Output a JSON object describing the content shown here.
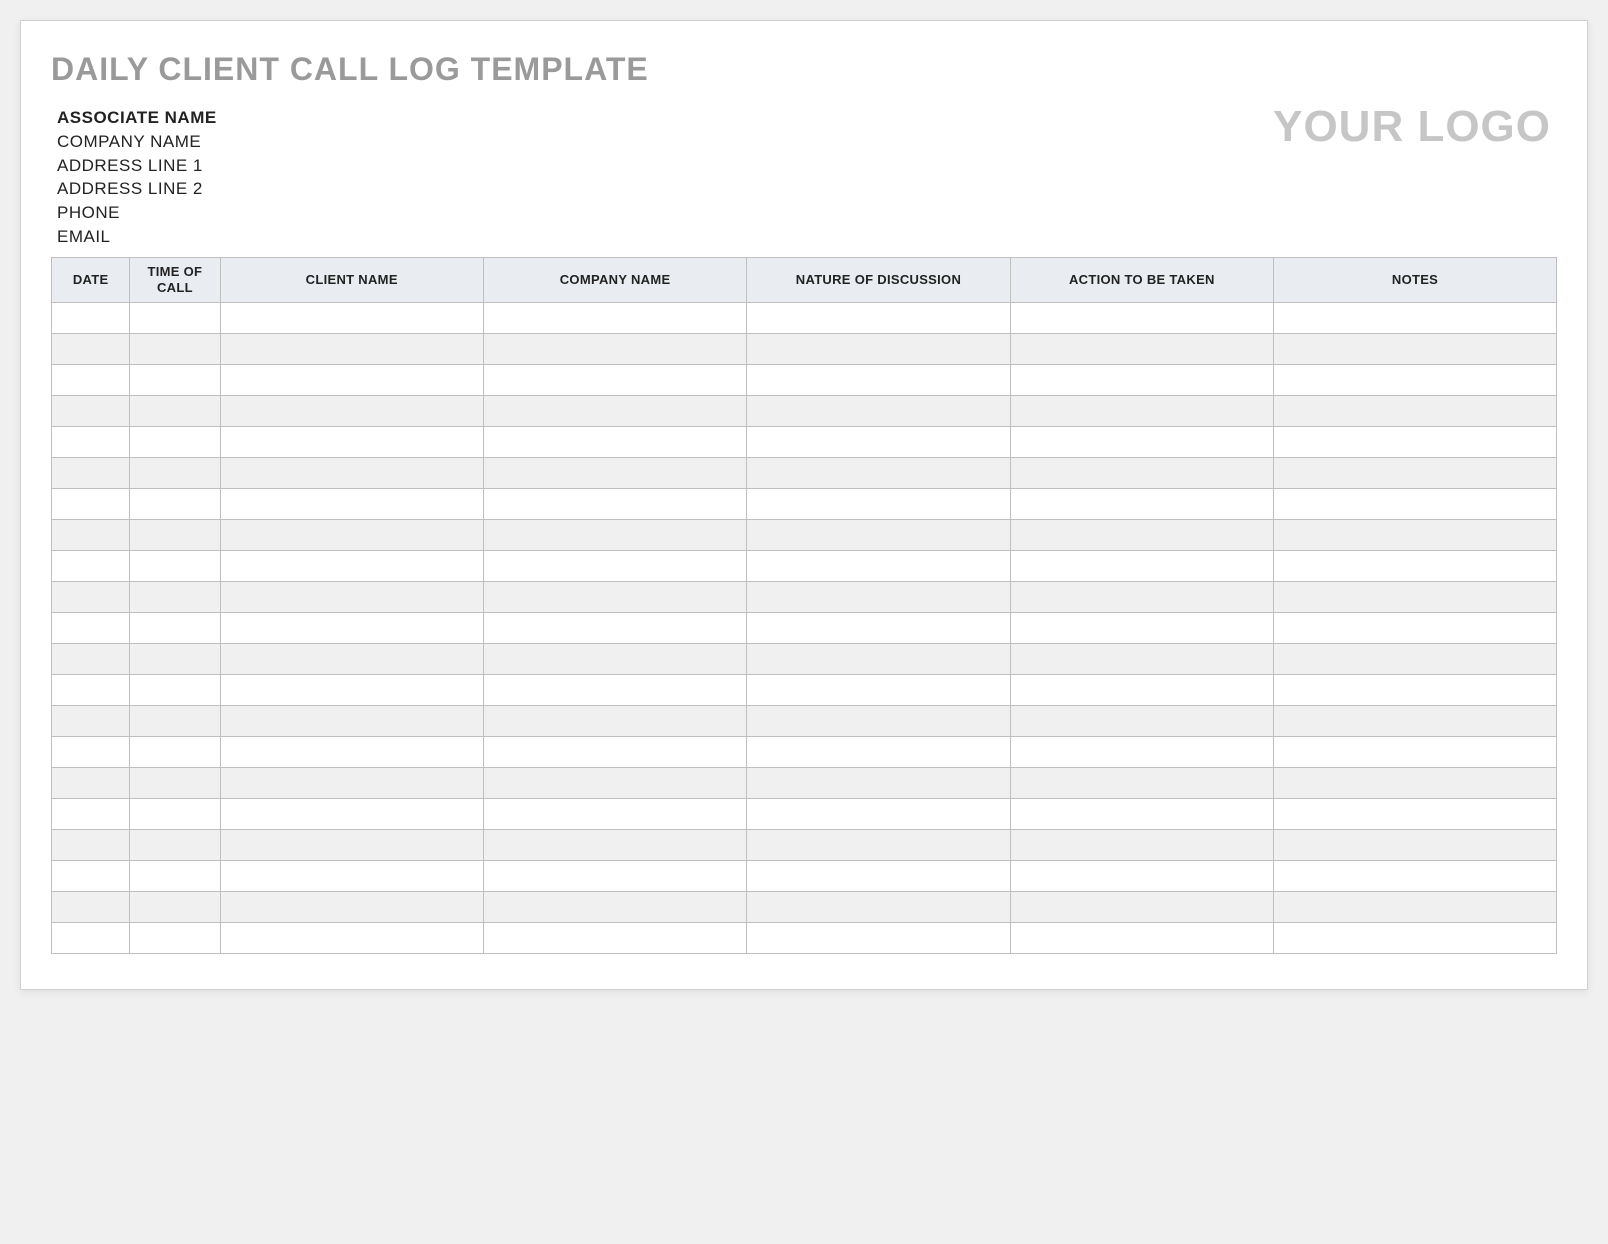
{
  "title": "DAILY CLIENT CALL LOG TEMPLATE",
  "info": {
    "associate_name": "ASSOCIATE NAME",
    "company_name": "COMPANY NAME",
    "address_line_1": "ADDRESS LINE 1",
    "address_line_2": "ADDRESS LINE 2",
    "phone": "PHONE",
    "email": "EMAIL"
  },
  "logo_text": "YOUR LOGO",
  "columns": [
    "DATE",
    "TIME OF CALL",
    "CLIENT NAME",
    "COMPANY NAME",
    "NATURE OF DISCUSSION",
    "ACTION TO BE TAKEN",
    "NOTES"
  ],
  "row_count": 21
}
